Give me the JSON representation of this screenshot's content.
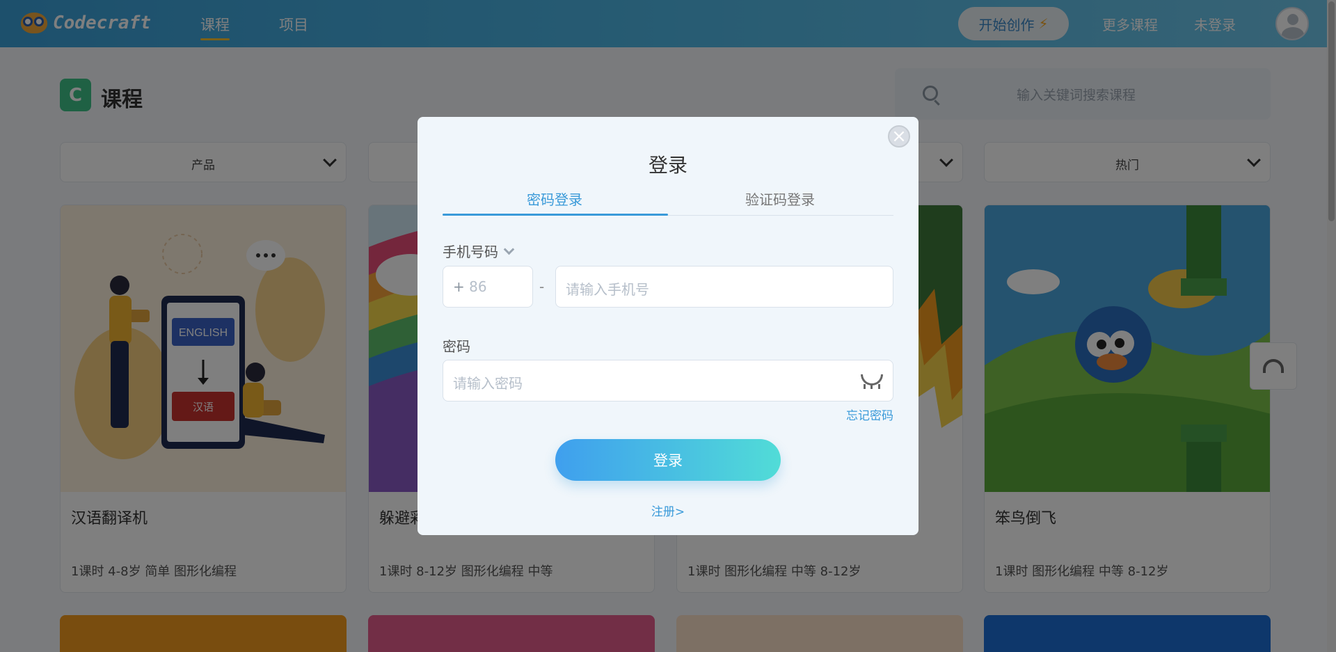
{
  "topbar": {
    "logo_text": "Codecraft",
    "nav": [
      {
        "label": "课程"
      },
      {
        "label": "项目"
      }
    ],
    "start_button": "开始创作",
    "more_courses": "更多课程",
    "login_status": "未登录"
  },
  "page": {
    "title": "课程",
    "search_placeholder": "输入关键词搜索课程"
  },
  "filters": [
    {
      "label": "产品"
    },
    {
      "label": ""
    },
    {
      "label": ""
    },
    {
      "label": "热门"
    }
  ],
  "cards": [
    {
      "title": "汉语翻译机",
      "meta": "1课时 4-8岁 简单 图形化编程",
      "english_label": "ENGLISH",
      "chinese_label": "汉语"
    },
    {
      "title": "躲避彩",
      "meta": "1课时 8-12岁 图形化编程 中等"
    },
    {
      "title": "",
      "meta": "1课时 图形化编程 中等 8-12岁"
    },
    {
      "title": "笨鸟倒飞",
      "meta": "1课时 图形化编程 中等 8-12岁"
    }
  ],
  "modal": {
    "title": "登录",
    "tabs": [
      {
        "label": "密码登录",
        "active": true
      },
      {
        "label": "验证码登录",
        "active": false
      }
    ],
    "phone_label": "手机号码",
    "country_code_prefix": "+",
    "country_code": "86",
    "phone_separator": "-",
    "phone_placeholder": "请输入手机号",
    "password_label": "密码",
    "password_placeholder": "请输入密码",
    "forgot_password": "忘记密码",
    "login_button": "登录",
    "register_link": "注册>"
  },
  "icons": {
    "close": "close-icon",
    "eye": "eye-closed-icon",
    "search": "search-icon",
    "bolt": "lightning-icon",
    "avatar": "user-avatar-icon",
    "support": "headset-icon"
  },
  "colors": {
    "accent": "#3a9ad9",
    "nav_gradient_start": "#3aa0d9",
    "nav_gradient_end": "#6fc7eb",
    "button_gradient_start": "#3f9fee",
    "button_gradient_end": "#51dcd7",
    "nav_active_underline": "#f6c233"
  }
}
